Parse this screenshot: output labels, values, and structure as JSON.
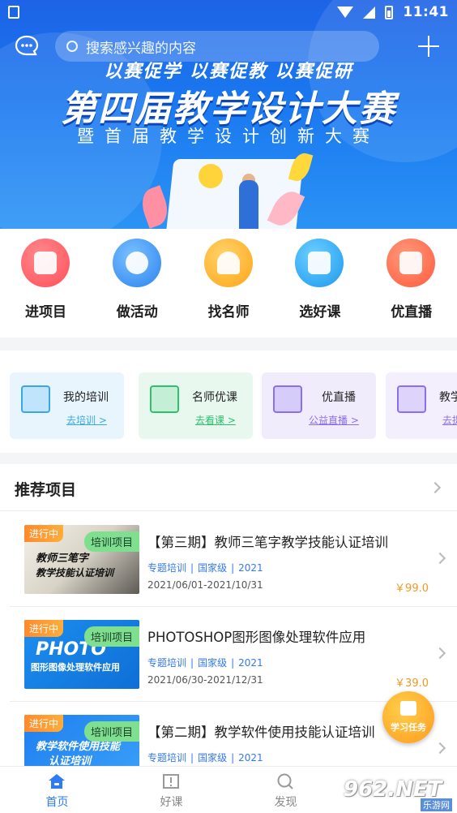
{
  "statusbar": {
    "time": "11:41"
  },
  "search": {
    "placeholder": "搜索感兴趣的内容"
  },
  "banner": {
    "slogan": "以赛促学  以赛促教  以赛促研",
    "title": "第四届教学设计大赛",
    "subtitle": "暨首届教学设计创新大赛"
  },
  "quick_items": [
    {
      "label": "进项目",
      "icon": "folder-icon",
      "color": "#ff5a5f"
    },
    {
      "label": "做活动",
      "icon": "target-icon",
      "color": "#2f8cf5"
    },
    {
      "label": "找名师",
      "icon": "teacher-icon",
      "color": "#ffb020"
    },
    {
      "label": "选好课",
      "icon": "tv-icon",
      "color": "#1fa2f2"
    },
    {
      "label": "优直播",
      "icon": "live-icon",
      "color": "#ff6a4d"
    }
  ],
  "service_cards": [
    {
      "title": "我的培训",
      "link": "去培训 >",
      "icon": "training-icon",
      "bg": "#e8f5fd",
      "accent": "#3aa8e8"
    },
    {
      "title": "名师优课",
      "link": "去看课 >",
      "icon": "book-icon",
      "bg": "#e8f8ef",
      "accent": "#2fbf6e"
    },
    {
      "title": "优直播",
      "link": "公益直播 >",
      "icon": "camera-icon",
      "bg": "#f0ecfc",
      "accent": "#8b6ff2"
    },
    {
      "title": "教学",
      "link": "去提",
      "icon": "chart-board-icon",
      "bg": "#f3effc",
      "accent": "#8b6ff2"
    }
  ],
  "recommend": {
    "title": "推荐项目",
    "items": [
      {
        "status": "进行中",
        "tag": "培训项目",
        "thumb_text": [
          "教师三笔字",
          "教学技能认证培训"
        ],
        "title": "【第三期】教师三笔字教学技能认证培训",
        "meta": [
          "专题培训",
          "国家级",
          "2021"
        ],
        "date": "2021/06/01-2021/10/31",
        "price": "￥99.0"
      },
      {
        "status": "进行中",
        "tag": "培训项目",
        "thumb_text": [
          "PHOTO",
          "图形图像处理软件应用"
        ],
        "title": "PHOTOSHOP图形图像处理软件应用",
        "meta": [
          "专题培训",
          "国家级",
          "2021"
        ],
        "date": "2021/06/30-2021/12/31",
        "price": "￥39.0"
      },
      {
        "status": "进行中",
        "tag": "培训项目",
        "thumb_text": [
          "教学软件使用技能",
          "认证培训"
        ],
        "title": "【第二期】教学软件使用技能认证培训",
        "meta": [
          "专题培训",
          "国家级",
          "2021"
        ],
        "date": "",
        "price": ""
      }
    ]
  },
  "float_task": {
    "label": "学习任务"
  },
  "bottom_nav": [
    {
      "label": "首页",
      "icon": "home-icon",
      "active": true
    },
    {
      "label": "好课",
      "icon": "book-open-icon",
      "active": false
    },
    {
      "label": "发现",
      "icon": "discover-icon",
      "active": false
    },
    {
      "label": "",
      "icon": "profile-icon",
      "active": false
    }
  ],
  "watermark": {
    "number": "962.NET",
    "site": "乐游网"
  },
  "colors": {
    "accent": "#2d7cf6",
    "price": "#f09a21",
    "meta": "#3478f6",
    "status_orange": "#ff8a2b",
    "tag_green": "#7ee08f"
  }
}
